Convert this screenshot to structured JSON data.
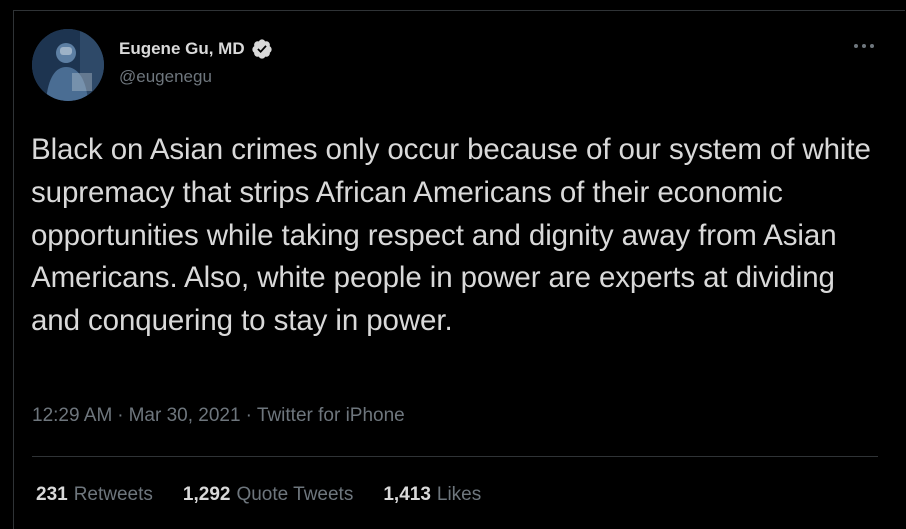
{
  "author": {
    "display_name": "Eugene Gu, MD",
    "handle": "@eugenegu",
    "verified_icon": "verified-badge-icon",
    "avatar_icon": "surgeon-avatar"
  },
  "more_icon": "more-options-icon",
  "tweet": {
    "text": "Black on Asian crimes only occur because of our system of white supremacy that strips African Americans of their economic opportunities while taking respect and dignity away from Asian Americans. Also, white people in power are experts at dividing and conquering to stay in power."
  },
  "meta": {
    "time": "12:29 AM",
    "sep1": "·",
    "date": "Mar 30, 2021",
    "sep2": "·",
    "source": "Twitter for iPhone"
  },
  "stats": {
    "retweets_count": "231",
    "retweets_label": "Retweets",
    "quotes_count": "1,292",
    "quotes_label": "Quote Tweets",
    "likes_count": "1,413",
    "likes_label": "Likes"
  },
  "colors": {
    "background": "#000000",
    "text": "#d9d9d9",
    "secondary": "#6e767d",
    "border": "#2f3336"
  }
}
